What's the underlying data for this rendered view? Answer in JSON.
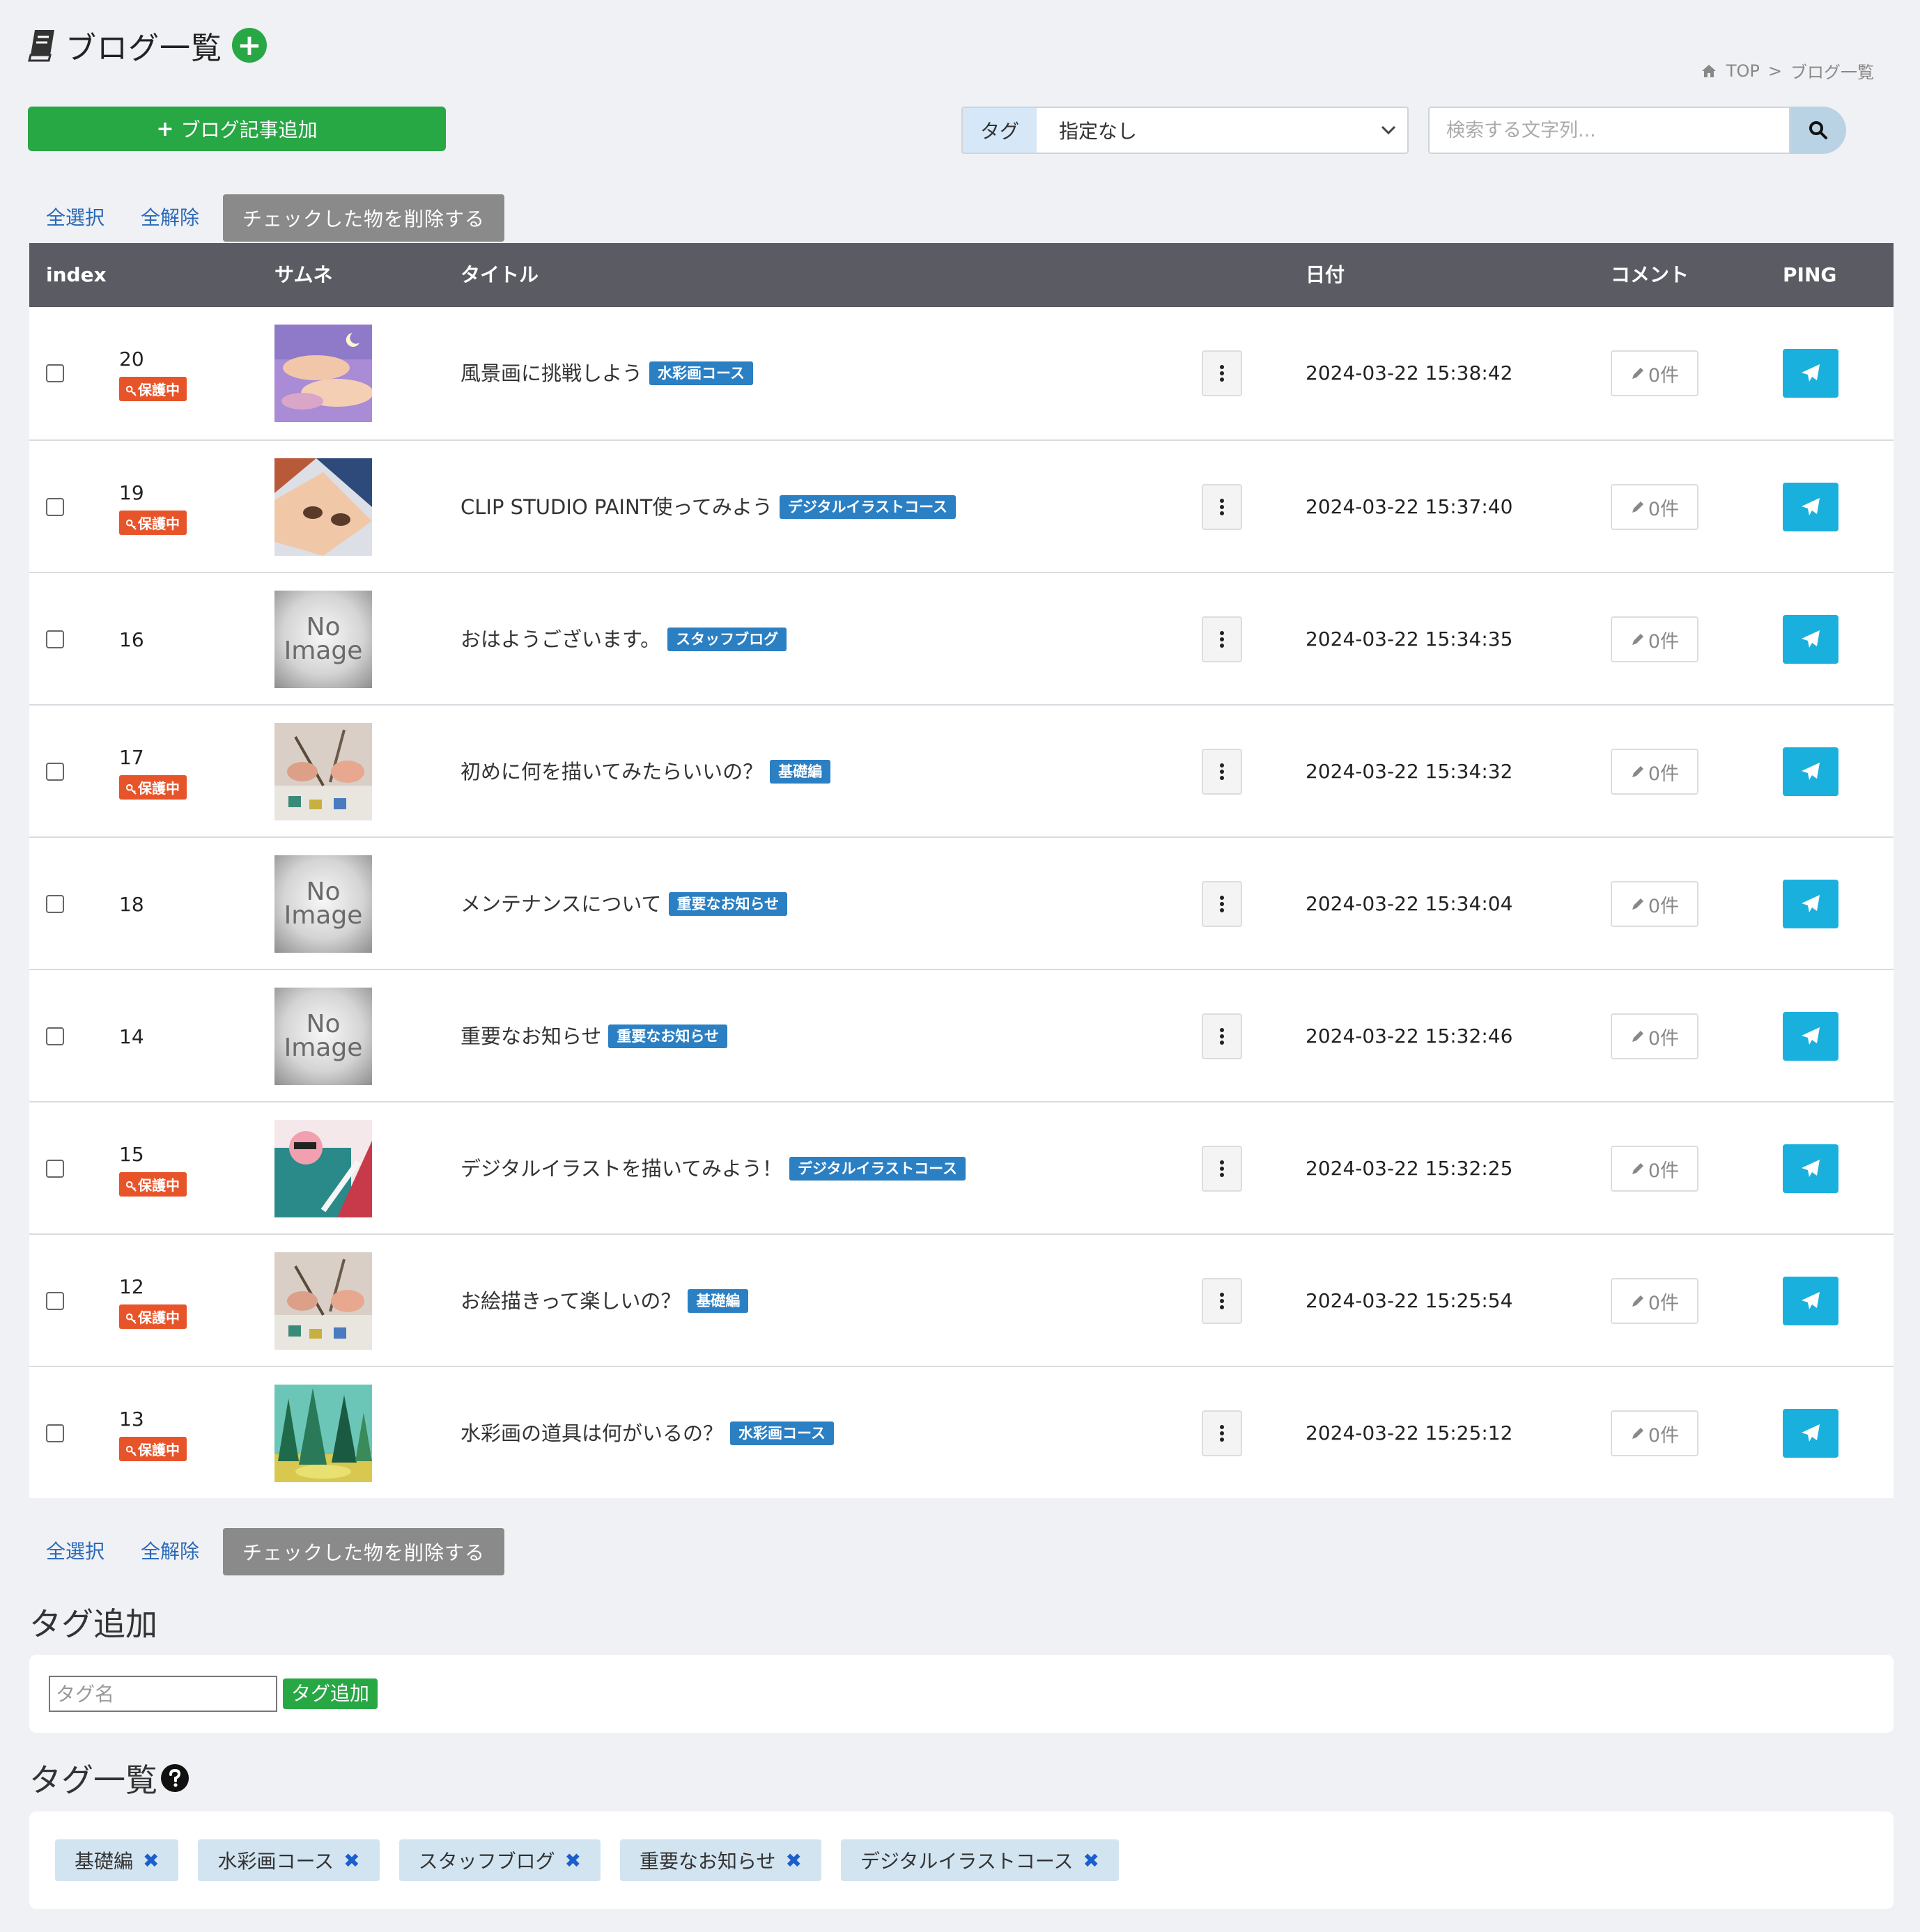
{
  "header": {
    "title": "ブログ一覧"
  },
  "breadcrumb": {
    "top": "TOP",
    "sep": ">",
    "current": "ブログ一覧"
  },
  "toolbar": {
    "add_label": "ブログ記事追加",
    "tag_label": "タグ",
    "tag_selected": "指定なし",
    "search_placeholder": "検索する文字列..."
  },
  "bulk": {
    "select_all": "全選択",
    "deselect_all": "全解除",
    "delete_checked": "チェックした物を削除する"
  },
  "table": {
    "columns": {
      "index": "index",
      "thumb": "サムネ",
      "title": "タイトル",
      "date": "日付",
      "comment": "コメント",
      "ping": "PING"
    },
    "protected_label": "保護中",
    "no_image": [
      "No",
      "Image"
    ],
    "rows": [
      {
        "index": "20",
        "protected": true,
        "thumb": "watercolor-clouds",
        "title": "風景画に挑戦しよう",
        "tag": "水彩画コース",
        "date": "2024-03-22 15:38:42",
        "comments": "0件"
      },
      {
        "index": "19",
        "protected": true,
        "thumb": "digital-face",
        "title": "CLIP STUDIO PAINT使ってみよう",
        "tag": "デジタルイラストコース",
        "date": "2024-03-22 15:37:40",
        "comments": "0件"
      },
      {
        "index": "16",
        "protected": false,
        "thumb": "no-image",
        "title": "おはようございます。",
        "tag": "スタッフブログ",
        "date": "2024-03-22 15:34:35",
        "comments": "0件"
      },
      {
        "index": "17",
        "protected": true,
        "thumb": "painting-hands",
        "title": "初めに何を描いてみたらいいの？",
        "tag": "基礎編",
        "date": "2024-03-22 15:34:32",
        "comments": "0件"
      },
      {
        "index": "18",
        "protected": false,
        "thumb": "no-image",
        "title": "メンテナンスについて",
        "tag": "重要なお知らせ",
        "date": "2024-03-22 15:34:04",
        "comments": "0件"
      },
      {
        "index": "14",
        "protected": false,
        "thumb": "no-image",
        "title": "重要なお知らせ",
        "tag": "重要なお知らせ",
        "date": "2024-03-22 15:32:46",
        "comments": "0件"
      },
      {
        "index": "15",
        "protected": true,
        "thumb": "tablet-drawing",
        "title": "デジタルイラストを描いてみよう！",
        "tag": "デジタルイラストコース",
        "date": "2024-03-22 15:32:25",
        "comments": "0件"
      },
      {
        "index": "12",
        "protected": true,
        "thumb": "painting-hands",
        "title": "お絵描きって楽しいの？",
        "tag": "基礎編",
        "date": "2024-03-22 15:25:54",
        "comments": "0件"
      },
      {
        "index": "13",
        "protected": true,
        "thumb": "watercolor-forest",
        "title": "水彩画の道具は何がいるの？",
        "tag": "水彩画コース",
        "date": "2024-03-22 15:25:12",
        "comments": "0件"
      }
    ]
  },
  "tag_add": {
    "title": "タグ追加",
    "placeholder": "タグ名",
    "button": "タグ追加"
  },
  "tag_list": {
    "title": "タグ一覧",
    "remove_glyph": "✖",
    "tags": [
      "基礎編",
      "水彩画コース",
      "スタッフブログ",
      "重要なお知らせ",
      "デジタルイラストコース"
    ]
  },
  "colors": {
    "accent_green": "#28a745",
    "header_bg": "#5a5b63",
    "tag_blue": "#2b7fc3",
    "protected_red": "#e8542a",
    "ping_blue": "#1ab0de"
  }
}
